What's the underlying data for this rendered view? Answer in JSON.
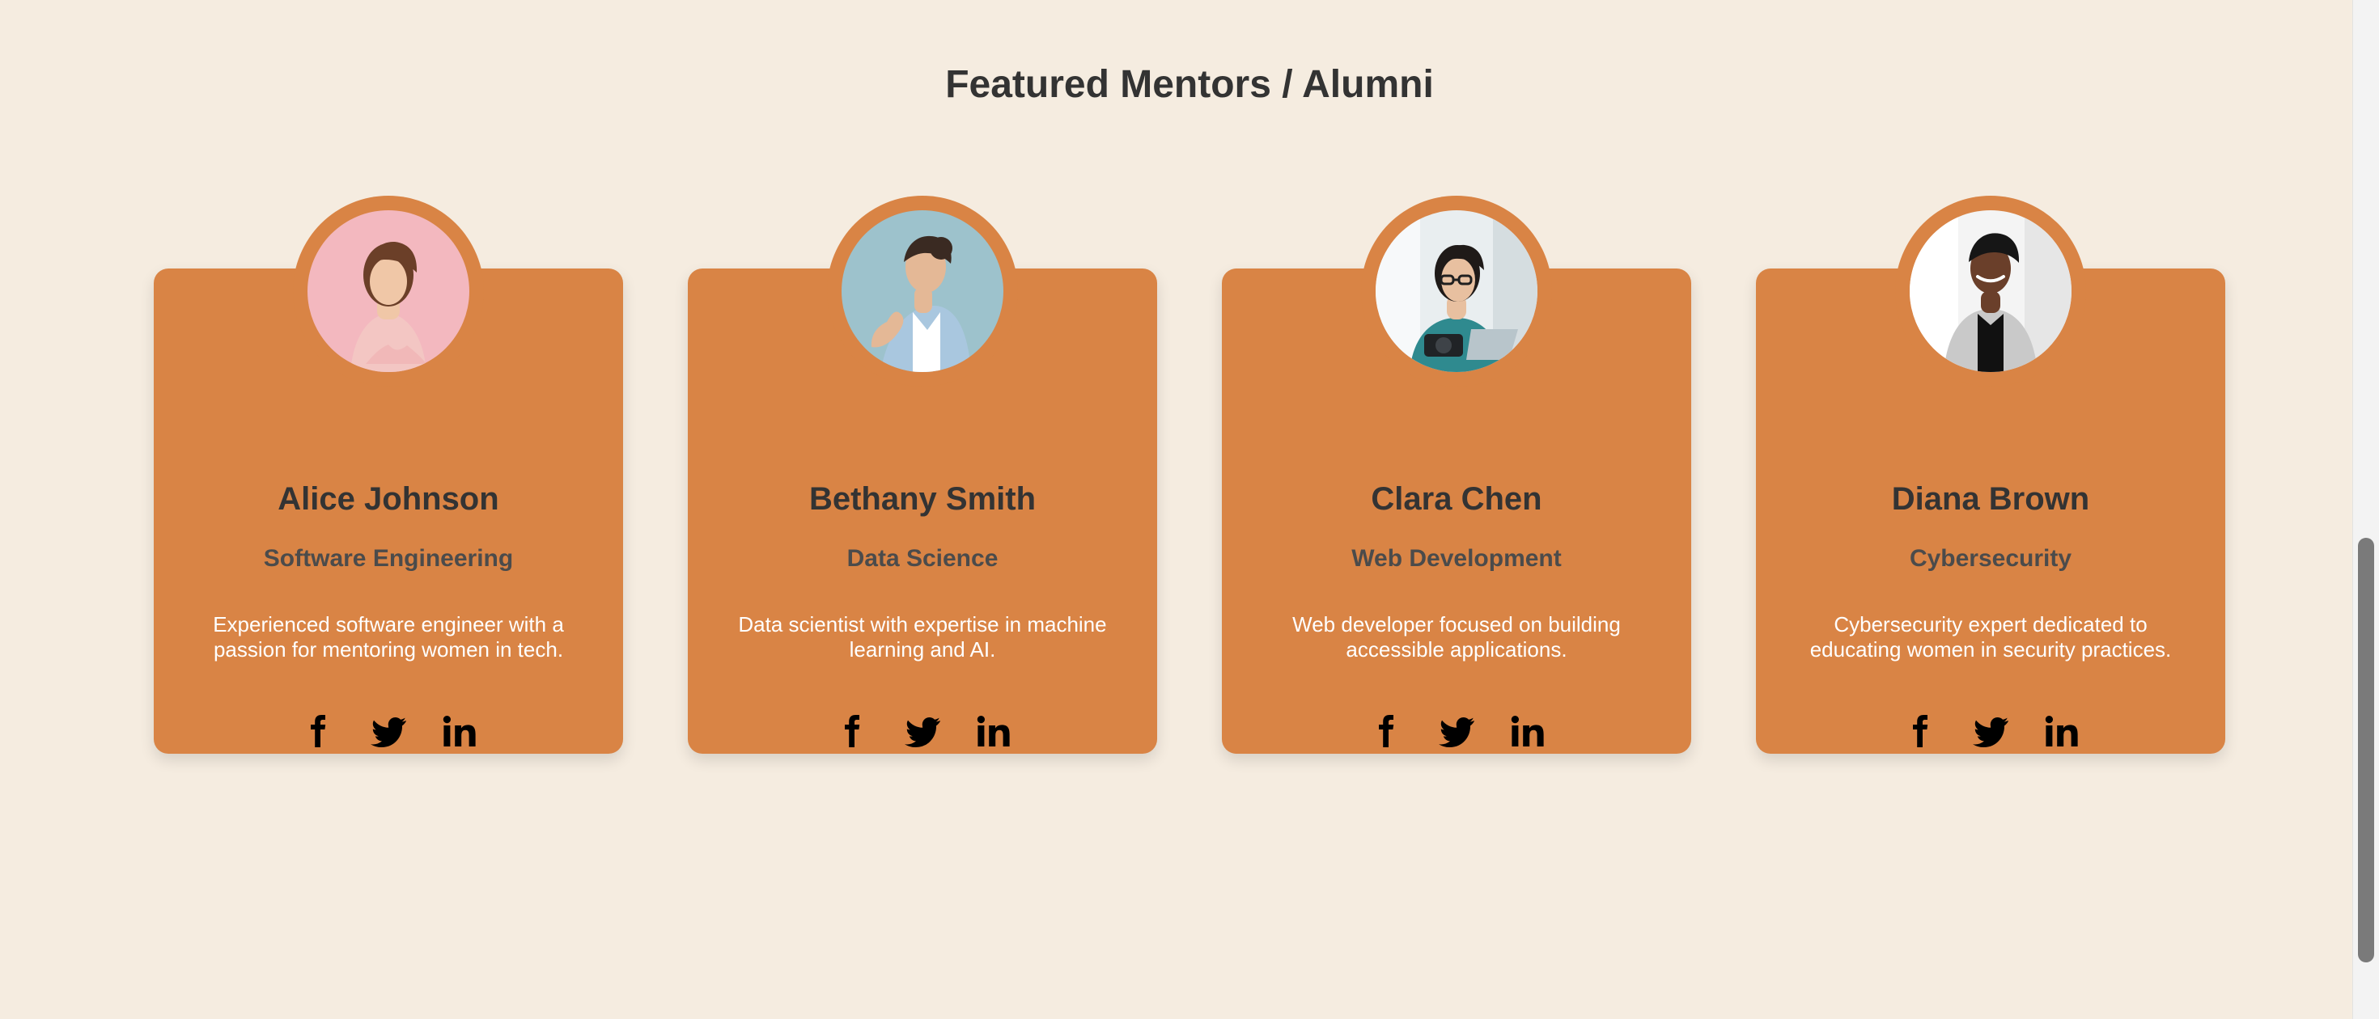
{
  "section": {
    "title": "Featured Mentors / Alumni"
  },
  "mentors": [
    {
      "name": "Alice Johnson",
      "field": "Software Engineering",
      "description": "Experienced software engineer with a passion for mentoring women in tech.",
      "avatar_bg": "#f3b8bf",
      "avatar_skin": "#f0c7a7",
      "avatar_hair": "#6b3f28",
      "avatar_clothes": "#f3c6c3"
    },
    {
      "name": "Bethany Smith",
      "field": "Data Science",
      "description": "Data scientist with expertise in machine learning and AI.",
      "avatar_bg": "#9dc2cc",
      "avatar_skin": "#e4b896",
      "avatar_hair": "#3a2a22",
      "avatar_clothes": "#a9c7df"
    },
    {
      "name": "Clara Chen",
      "field": "Web Development",
      "description": "Web developer focused on building accessible applications.",
      "avatar_bg": "#e9eef0",
      "avatar_skin": "#e8c0a0",
      "avatar_hair": "#1f1a18",
      "avatar_clothes": "#2f8a8f"
    },
    {
      "name": "Diana Brown",
      "field": "Cybersecurity",
      "description": "Cybersecurity expert dedicated to educating women in security practices.",
      "avatar_bg": "#f4f4f4",
      "avatar_skin": "#6a3f2a",
      "avatar_hair": "#161616",
      "avatar_clothes": "#c9c9c9"
    }
  ],
  "social_icons": [
    "facebook-icon",
    "twitter-icon",
    "linkedin-icon"
  ],
  "colors": {
    "background": "#f5ece0",
    "card": "#d98445",
    "title": "#333333",
    "field": "#4b4b4b",
    "description": "#ffffff",
    "icon": "#000000"
  }
}
